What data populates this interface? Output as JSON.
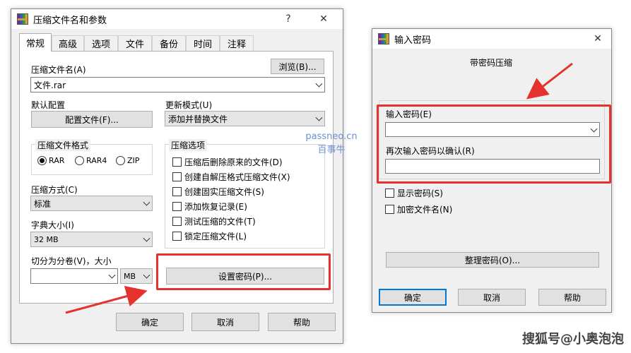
{
  "dialog1": {
    "title": "压缩文件名和参数",
    "help_glyph": "?",
    "close_glyph": "✕",
    "tabs": [
      "常规",
      "高级",
      "选项",
      "文件",
      "备份",
      "时间",
      "注释"
    ],
    "archive_name_label": "压缩文件名(A)",
    "browse_button": "浏览(B)...",
    "archive_name_value": "文件.rar",
    "default_profile_label": "默认配置",
    "profiles_button": "配置文件(F)...",
    "update_mode_label": "更新模式(U)",
    "update_mode_value": "添加并替换文件",
    "archive_format_title": "压缩文件格式",
    "formats": [
      "RAR",
      "RAR4",
      "ZIP"
    ],
    "selected_format": "RAR",
    "archive_options_title": "压缩选项",
    "options": [
      "压缩后删除原来的文件(D)",
      "创建自解压格式压缩文件(X)",
      "创建固实压缩文件(S)",
      "添加恢复记录(E)",
      "测试压缩的文件(T)",
      "锁定压缩文件(L)"
    ],
    "compression_method_label": "压缩方式(C)",
    "compression_method_value": "标准",
    "dictionary_size_label": "字典大小(I)",
    "dictionary_size_value": "32 MB",
    "split_label": "切分为分卷(V)，大小",
    "split_value": "",
    "split_unit": "MB",
    "set_password_button": "设置密码(P)...",
    "ok_button": "确定",
    "cancel_button": "取消",
    "help_button": "帮助"
  },
  "dialog2": {
    "title": "输入密码",
    "close_glyph": "✕",
    "header_text": "带密码压缩",
    "enter_password_label": "输入密码(E)",
    "enter_password_value": "",
    "reenter_password_label": "再次输入密码以确认(R)",
    "reenter_password_value": "",
    "show_password_label": "显示密码(S)",
    "encrypt_names_label": "加密文件名(N)",
    "organize_passwords_button": "整理密码(O)...",
    "ok_button": "确定",
    "cancel_button": "取消",
    "help_button": "帮助"
  },
  "watermark": {
    "line1": "passneo.cn",
    "line2": "百事牛"
  },
  "brand": "搜狐号@小奥泡泡",
  "colors": {
    "highlight": "#e5322d",
    "default_button": "#0078d7",
    "dialog_bg": "#f0f0f0"
  }
}
